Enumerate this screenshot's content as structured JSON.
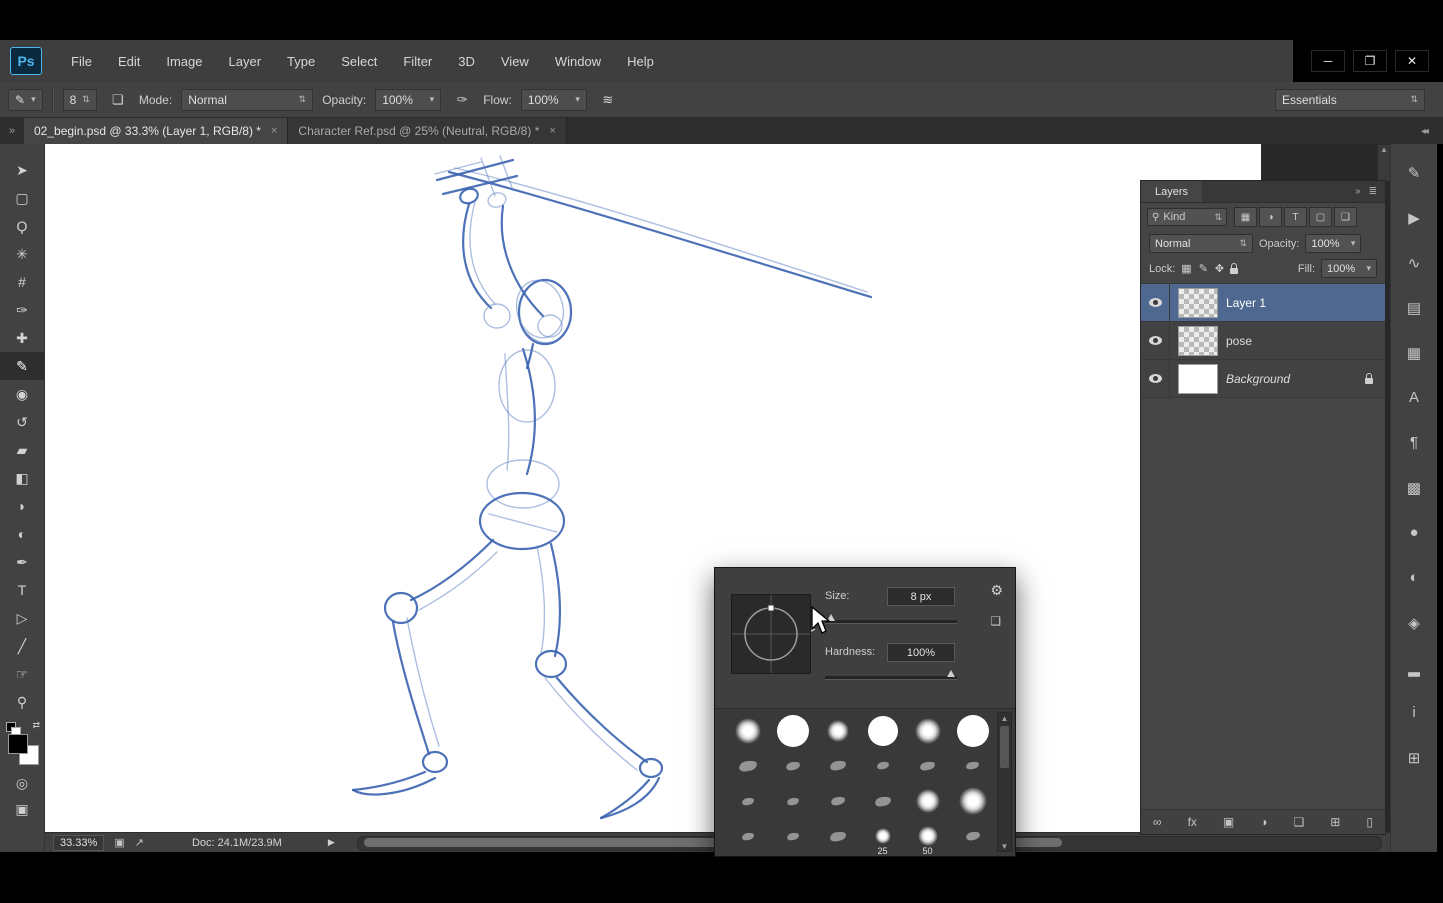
{
  "window": {
    "controls": [
      {
        "name": "minimize",
        "glyph": "─"
      },
      {
        "name": "maximize",
        "glyph": "❐"
      },
      {
        "name": "close",
        "glyph": "✕"
      }
    ]
  },
  "menu": {
    "logo": "Ps",
    "items": [
      "File",
      "Edit",
      "Image",
      "Layer",
      "Type",
      "Select",
      "Filter",
      "3D",
      "View",
      "Window",
      "Help"
    ]
  },
  "options": {
    "tool_glyph": "✎",
    "tool_caret": "▾",
    "brush_size": "8",
    "size_stepper": "⇅",
    "panel_toggle_glyph": "❏",
    "mode_label": "Mode:",
    "mode_value": "Normal",
    "mode_stepper": "⇅",
    "opacity_label": "Opacity:",
    "opacity_value": "100%",
    "pressure_glyph": "✑",
    "flow_label": "Flow:",
    "flow_value": "100%",
    "airbrush_glyph": "≋",
    "workspace": "Essentials",
    "workspace_stepper": "⇅"
  },
  "tabbar": {
    "left_chevron": "»",
    "right_chevron": "◂◂",
    "tabs": [
      {
        "label": "02_begin.psd @ 33.3% (Layer 1, RGB/8) *",
        "close": "×",
        "active": true
      },
      {
        "label": "Character Ref.psd @ 25% (Neutral, RGB/8) *",
        "close": "×"
      }
    ]
  },
  "tools": [
    {
      "name": "move-tool",
      "glyph": "➤"
    },
    {
      "name": "marquee-tool",
      "glyph": "▢"
    },
    {
      "name": "lasso-tool",
      "glyph": "Ϙ"
    },
    {
      "name": "quick-selection-tool",
      "glyph": "✳"
    },
    {
      "name": "crop-tool",
      "glyph": "#"
    },
    {
      "name": "eyedropper-tool",
      "glyph": "✑"
    },
    {
      "name": "healing-brush-tool",
      "glyph": "✚"
    },
    {
      "name": "brush-tool",
      "glyph": "✎",
      "selected": true
    },
    {
      "name": "clone-stamp-tool",
      "glyph": "◉"
    },
    {
      "name": "history-brush-tool",
      "glyph": "↺"
    },
    {
      "name": "eraser-tool",
      "glyph": "▰"
    },
    {
      "name": "gradient-tool",
      "glyph": "◧"
    },
    {
      "name": "blur-tool",
      "glyph": "◗"
    },
    {
      "name": "dodge-tool",
      "glyph": "◐"
    },
    {
      "name": "pen-tool",
      "glyph": "✒"
    },
    {
      "name": "type-tool",
      "glyph": "T"
    },
    {
      "name": "path-selection-tool",
      "glyph": "▷"
    },
    {
      "name": "line-tool",
      "glyph": "╱"
    },
    {
      "name": "hand-tool",
      "glyph": "☞"
    },
    {
      "name": "zoom-tool",
      "glyph": "⚲"
    }
  ],
  "toolbar_bottom": {
    "swap_glyph": "⇄",
    "quick_mask_glyph": "◎",
    "screen_mode_glyph": "▣"
  },
  "layers_panel": {
    "title": "Layers",
    "collapse_glyph": "»",
    "menu_glyph": "≣",
    "filter": {
      "search_glyph": "⚲",
      "kind_label": "Kind",
      "stepper": "⇅",
      "type_icons": [
        {
          "name": "filter-pixel-layers-icon",
          "glyph": "▦"
        },
        {
          "name": "filter-adjustment-layers-icon",
          "glyph": "◑"
        },
        {
          "name": "filter-type-layers-icon",
          "glyph": "T"
        },
        {
          "name": "filter-shape-layers-icon",
          "glyph": "▢"
        },
        {
          "name": "filter-smart-objects-icon",
          "glyph": "❏"
        }
      ]
    },
    "blend_mode": "Normal",
    "blend_stepper": "⇅",
    "opacity_label": "Opacity:",
    "opacity_value": "100%",
    "opacity_caret": "▾",
    "lock_label": "Lock:",
    "lock_icons": [
      {
        "name": "lock-transparency-icon",
        "glyph": "▦"
      },
      {
        "name": "lock-pixels-icon",
        "glyph": "✎"
      },
      {
        "name": "lock-position-icon",
        "glyph": "✥"
      }
    ],
    "fill_label": "Fill:",
    "fill_value": "100%",
    "fill_caret": "▾",
    "layers": [
      {
        "name": "Layer 1",
        "selected": true,
        "thumb": "checker"
      },
      {
        "name": "pose",
        "thumb": "checker"
      },
      {
        "name": "Background",
        "thumb": "white",
        "locked": true,
        "italic": true
      }
    ],
    "bottom_icons": [
      {
        "name": "link-layers-icon",
        "glyph": "∞"
      },
      {
        "name": "layer-style-icon",
        "glyph": "fx"
      },
      {
        "name": "layer-mask-icon",
        "glyph": "▣"
      },
      {
        "name": "adjustment-layer-icon",
        "glyph": "◑"
      },
      {
        "name": "new-group-icon",
        "glyph": "❏"
      },
      {
        "name": "new-layer-icon",
        "glyph": "⊞"
      },
      {
        "name": "delete-layer-icon",
        "glyph": "▯"
      }
    ]
  },
  "dock_icons": [
    {
      "name": "dock-brushes-panel-icon",
      "glyph": "✎"
    },
    {
      "name": "dock-actions-panel-icon",
      "glyph": "▶"
    },
    {
      "name": "dock-tool-presets-panel-icon",
      "glyph": "∿"
    },
    {
      "name": "dock-layer-comps-panel-icon",
      "glyph": "▤"
    },
    {
      "name": "dock-channels-panel-icon",
      "glyph": "▦"
    },
    {
      "name": "dock-character-panel-icon",
      "glyph": "A"
    },
    {
      "name": "dock-paragraph-panel-icon",
      "glyph": "¶"
    },
    {
      "name": "dock-swatches-panel-icon",
      "glyph": "▩"
    },
    {
      "name": "dock-color-panel-icon",
      "glyph": "●"
    },
    {
      "name": "dock-adjustments-panel-icon",
      "glyph": "◐"
    },
    {
      "name": "dock-styles-panel-icon",
      "glyph": "◈"
    },
    {
      "name": "dock-histogram-panel-icon",
      "glyph": "▂"
    },
    {
      "name": "dock-info-panel-icon",
      "glyph": "i"
    },
    {
      "name": "dock-navigator-panel-icon",
      "glyph": "⊞"
    }
  ],
  "brush_panel": {
    "size_label": "Size:",
    "size_value": "8 px",
    "hardness_label": "Hardness:",
    "hardness_value": "100%",
    "gear_glyph": "⚙",
    "new_preset_glyph": "❏",
    "preview_arrow": "▸",
    "scroll_up": "▲",
    "scroll_down": "▼",
    "presets": [
      {
        "t": "soft",
        "d": 26
      },
      {
        "t": "hard",
        "d": 32
      },
      {
        "t": "soft",
        "d": 22
      },
      {
        "t": "hard",
        "d": 30
      },
      {
        "t": "soft",
        "d": 26
      },
      {
        "t": "hard",
        "d": 32
      },
      {
        "t": "tip",
        "d": 18
      },
      {
        "t": "tip",
        "d": 14
      },
      {
        "t": "tip",
        "d": 16
      },
      {
        "t": "tip",
        "d": 12
      },
      {
        "t": "tip",
        "d": 15
      },
      {
        "t": "tip",
        "d": 13
      },
      {
        "t": "tip",
        "d": 12
      },
      {
        "t": "tip",
        "d": 12
      },
      {
        "t": "tip",
        "d": 14
      },
      {
        "t": "tip",
        "d": 16
      },
      {
        "t": "soft",
        "d": 24
      },
      {
        "t": "soft",
        "d": 28
      },
      {
        "t": "tip",
        "d": 12
      },
      {
        "t": "tip",
        "d": 12
      },
      {
        "t": "tip",
        "d": 16
      },
      {
        "t": "soft",
        "d": 16,
        "label": "25"
      },
      {
        "t": "soft",
        "d": 20,
        "label": "50"
      },
      {
        "t": "tip",
        "d": 14
      }
    ]
  },
  "status": {
    "zoom": "33.33%",
    "badge_glyph": "▣",
    "share_glyph": "↗",
    "doc": "Doc: 24.1M/23.9M",
    "menu_arrow": "▶"
  },
  "colors": {
    "accent_blue": "#4db5f0",
    "selection_blue": "#4e688f",
    "sketch_blue": "#3a63b0"
  }
}
